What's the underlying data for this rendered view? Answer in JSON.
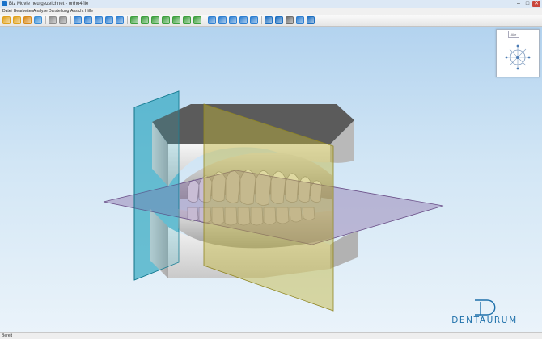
{
  "window": {
    "title": "Biz Movie neu gezeichnet - ortho4file",
    "buttons": {
      "minimize": "–",
      "maximize": "□",
      "close": "✕"
    }
  },
  "menu": {
    "items": [
      {
        "id": "datei",
        "label": "Datei"
      },
      {
        "id": "bearbeiten",
        "label": "Bearbeiten"
      },
      {
        "id": "analyse",
        "label": "Analyse"
      },
      {
        "id": "darstellung",
        "label": "Darstellung"
      },
      {
        "id": "ansicht",
        "label": "Ansicht"
      },
      {
        "id": "hilfe",
        "label": "Hilfe"
      }
    ]
  },
  "toolbar": {
    "icons": [
      {
        "name": "open-file-icon",
        "color": "#e0a21f"
      },
      {
        "name": "save-file-icon",
        "color": "#e0a21f"
      },
      {
        "name": "export-icon",
        "color": "#d88a1a"
      },
      {
        "name": "import-icon",
        "color": "#3c8fd6"
      },
      {
        "name": "undo-icon",
        "color": "#8c8c8c"
      },
      {
        "name": "redo-icon",
        "color": "#8c8c8c"
      },
      {
        "name": "select-icon",
        "color": "#2e7fd1"
      },
      {
        "name": "zoom-in-icon",
        "color": "#2e7fd1"
      },
      {
        "name": "zoom-out-icon",
        "color": "#2e7fd1"
      },
      {
        "name": "zoom-fit-icon",
        "color": "#2e7fd1"
      },
      {
        "name": "rotate-icon",
        "color": "#2e7fd1"
      },
      {
        "name": "view-front-icon",
        "color": "#3fa03f"
      },
      {
        "name": "view-back-icon",
        "color": "#3fa03f"
      },
      {
        "name": "view-left-icon",
        "color": "#3fa03f"
      },
      {
        "name": "view-right-icon",
        "color": "#3fa03f"
      },
      {
        "name": "view-top-icon",
        "color": "#3fa03f"
      },
      {
        "name": "view-bottom-icon",
        "color": "#3fa03f"
      },
      {
        "name": "view-iso-icon",
        "color": "#3fa03f"
      },
      {
        "name": "measure-icon",
        "color": "#2e7fd1"
      },
      {
        "name": "arch-icon",
        "color": "#2e7fd1"
      },
      {
        "name": "section-icon",
        "color": "#2e7fd1"
      },
      {
        "name": "plane-icon",
        "color": "#2e7fd1"
      },
      {
        "name": "grid-icon",
        "color": "#2e7fd1"
      },
      {
        "name": "model-upper-icon",
        "color": "#1d6fc1"
      },
      {
        "name": "model-lower-icon",
        "color": "#1d6fc1"
      },
      {
        "name": "ruler-icon",
        "color": "#6d6d6d"
      },
      {
        "name": "table-icon",
        "color": "#2e7fd1"
      },
      {
        "name": "info-icon",
        "color": "#1d6fc1"
      }
    ]
  },
  "nav_cube": {
    "tab_label": "Alle"
  },
  "logo": {
    "text": "DENTAURUM",
    "color": "#1e70aa"
  },
  "statusbar": {
    "text": "Bereit"
  }
}
